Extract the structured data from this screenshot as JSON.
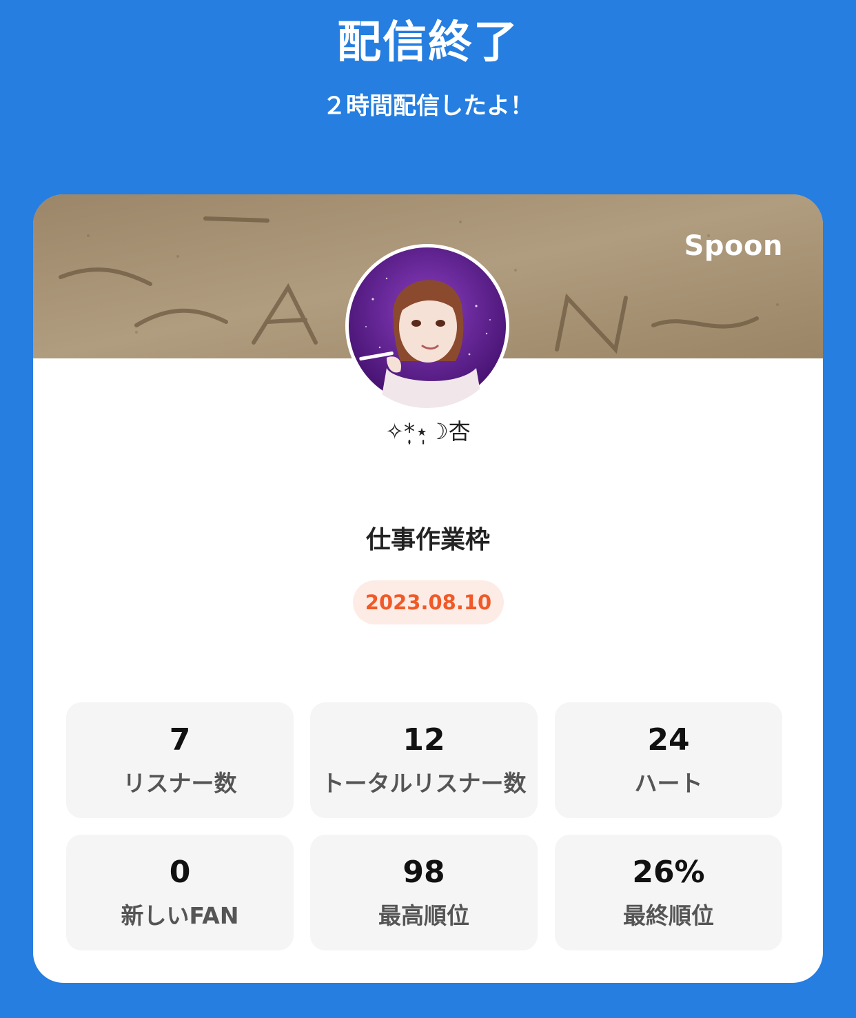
{
  "header": {
    "title": "配信終了",
    "subtitle": "２時間配信したよ！"
  },
  "card": {
    "brand": "Spoon",
    "username": "✧*̣̩⋆̩☽杏",
    "room_title": "仕事作業枠",
    "date": "2023.08.10"
  },
  "stats": [
    {
      "value": "7",
      "label": "リスナー数"
    },
    {
      "value": "12",
      "label": "トータルリスナー数"
    },
    {
      "value": "24",
      "label": "ハート"
    },
    {
      "value": "0",
      "label": "新しいFAN"
    },
    {
      "value": "98",
      "label": "最高順位"
    },
    {
      "value": "26%",
      "label": "最終順位"
    }
  ],
  "colors": {
    "background": "#257ee0",
    "date_text": "#f05a28",
    "date_badge": "#fdece6",
    "stat_tile": "#f5f5f5"
  }
}
